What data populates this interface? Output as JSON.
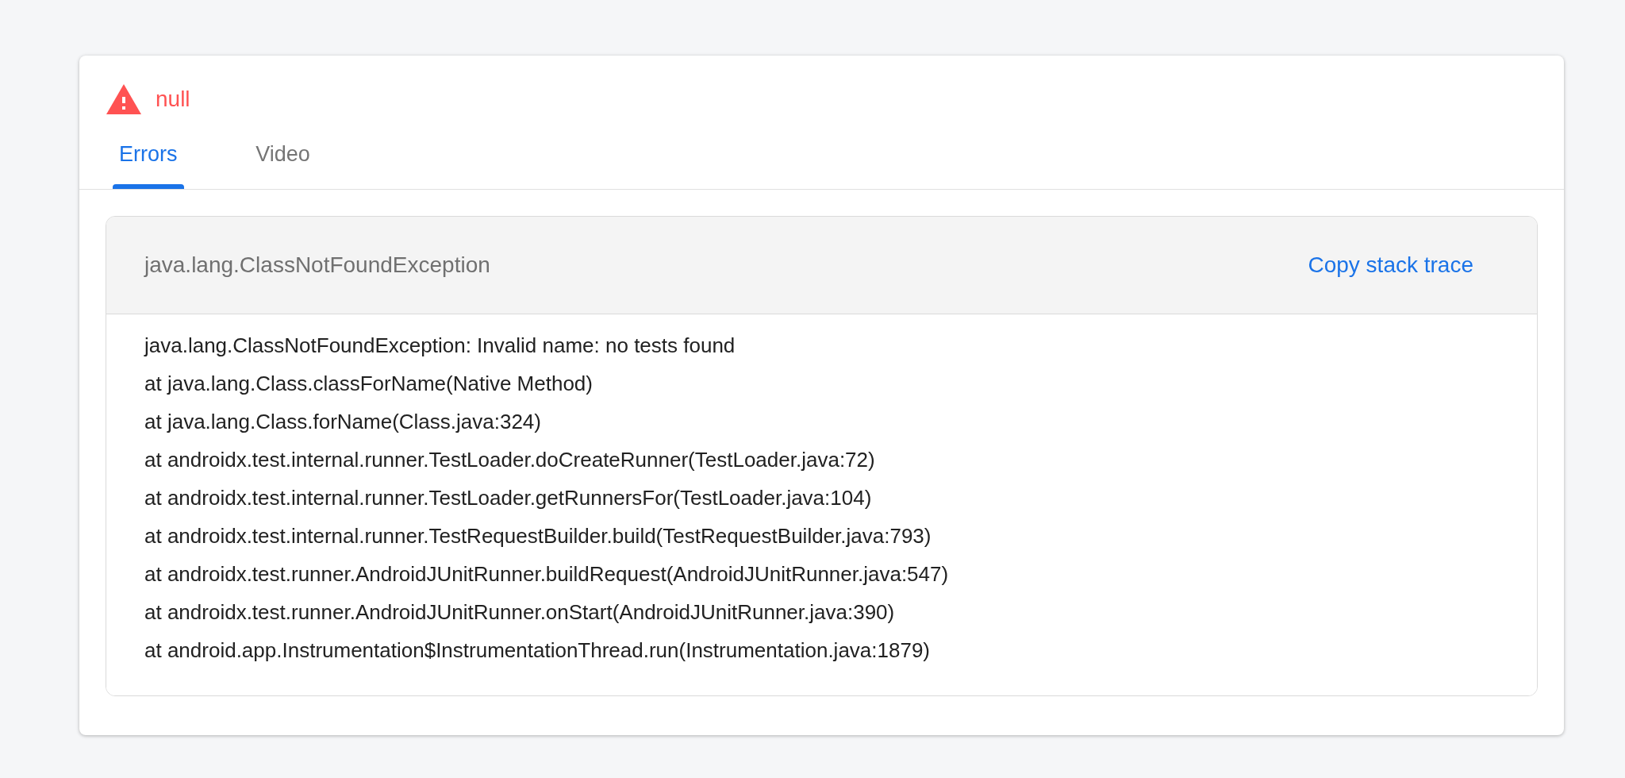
{
  "header": {
    "title": "null"
  },
  "tabs": [
    {
      "label": "Errors",
      "selected": true
    },
    {
      "label": "Video",
      "selected": false
    }
  ],
  "error_panel": {
    "title": "java.lang.ClassNotFoundException",
    "copy_button": "Copy stack trace",
    "stack_trace": [
      "java.lang.ClassNotFoundException: Invalid name: no tests found",
      "at java.lang.Class.classForName(Native Method)",
      "at java.lang.Class.forName(Class.java:324)",
      "at androidx.test.internal.runner.TestLoader.doCreateRunner(TestLoader.java:72)",
      "at androidx.test.internal.runner.TestLoader.getRunnersFor(TestLoader.java:104)",
      "at androidx.test.internal.runner.TestRequestBuilder.build(TestRequestBuilder.java:793)",
      "at androidx.test.runner.AndroidJUnitRunner.buildRequest(AndroidJUnitRunner.java:547)",
      "at androidx.test.runner.AndroidJUnitRunner.onStart(AndroidJUnitRunner.java:390)",
      "at android.app.Instrumentation$InstrumentationThread.run(Instrumentation.java:1879)"
    ]
  }
}
